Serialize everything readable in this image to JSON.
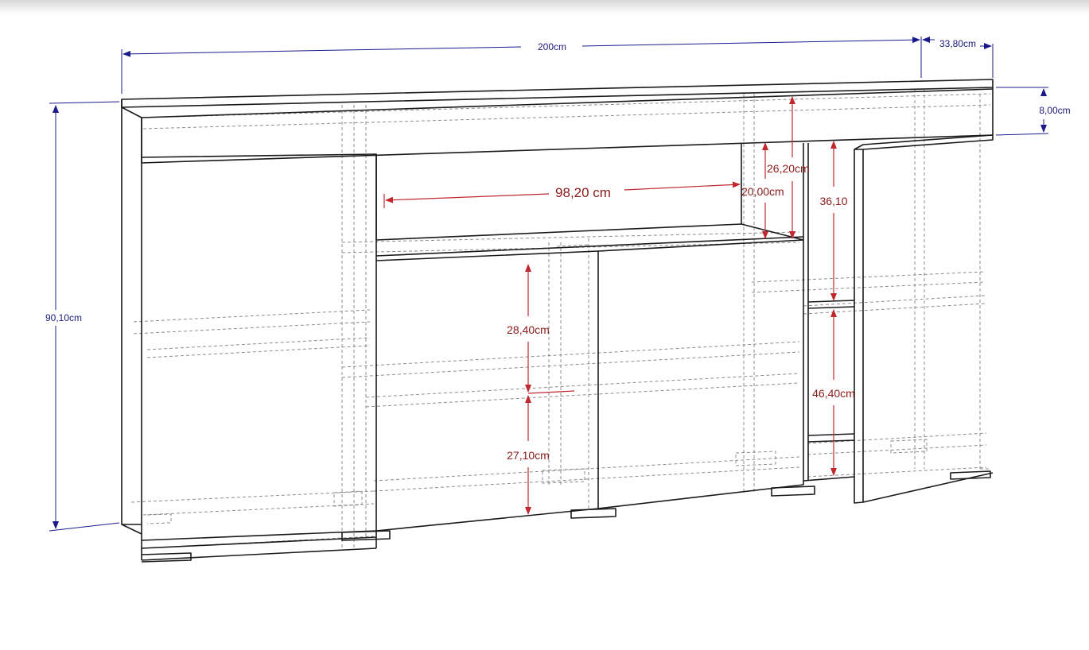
{
  "dimensions": {
    "width_total": "200cm",
    "depth": "33,80cm",
    "top_panel_height": "8,00cm",
    "total_height": "90,10cm",
    "open_niche_width": "98,20 cm",
    "niche_height_outer": "26,20cm",
    "niche_height_inner": "20,00cm",
    "right_upper_compartment": "36,10",
    "right_lower_compartment": "46,40cm",
    "center_upper_compartment": "28,40cm",
    "center_lower_compartment": "27,10cm"
  },
  "colors": {
    "outline": "#1a1a1a",
    "hidden_lines": "#8c8c8c",
    "dimension_blue": "#1a1a8c",
    "dimension_red": "#c0282d"
  }
}
